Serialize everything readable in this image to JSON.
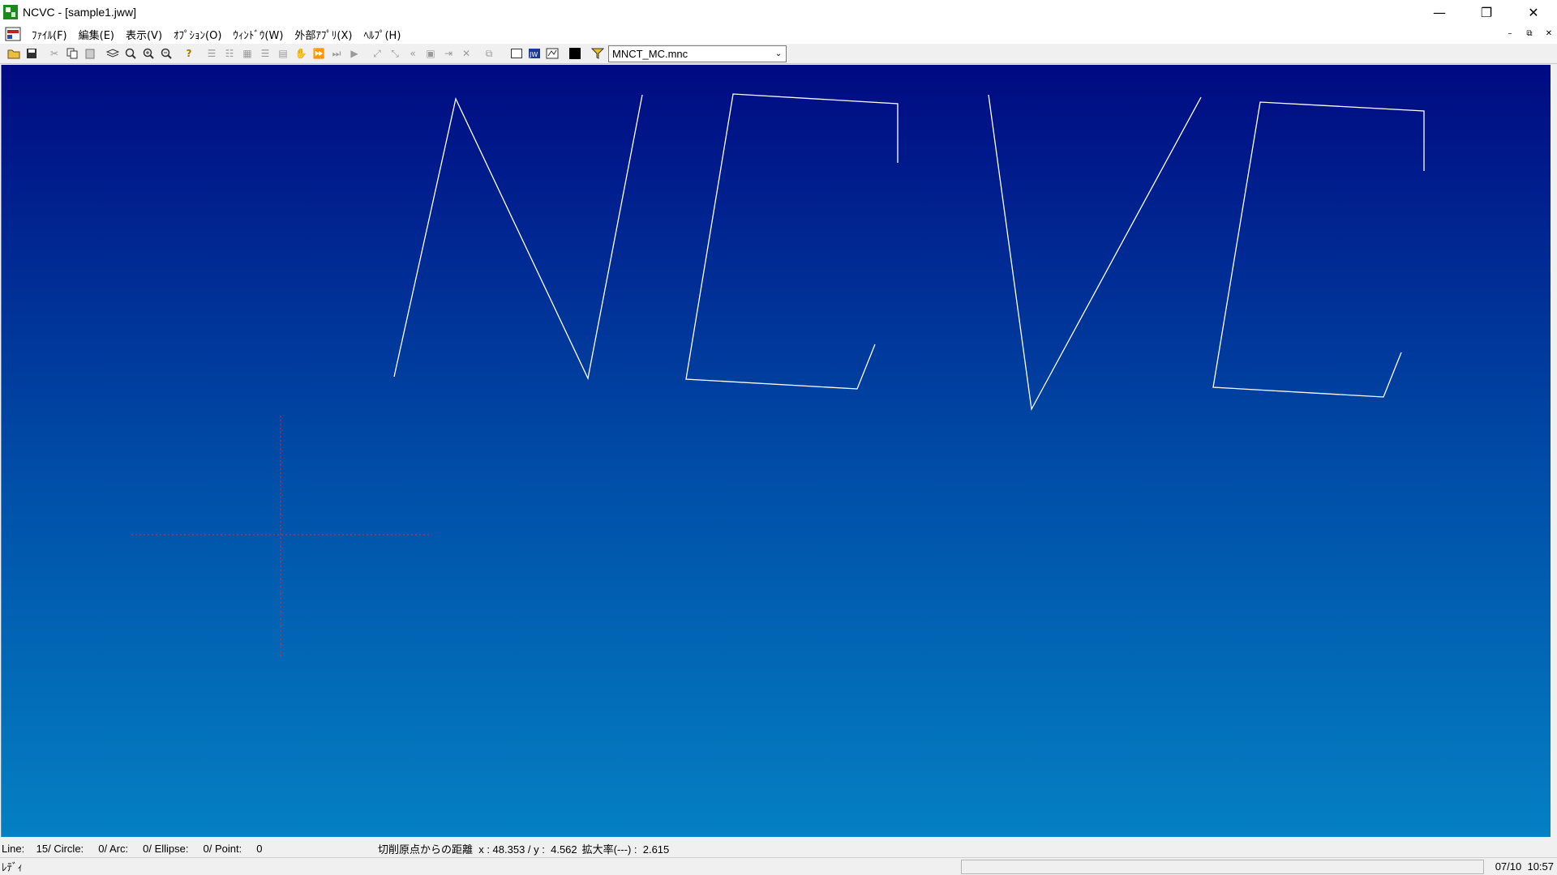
{
  "window": {
    "title": "NCVC - [sample1.jww]",
    "controls": {
      "minimize": "—",
      "restore": "❐",
      "close": "✕"
    }
  },
  "menu": {
    "items": [
      "ﾌｧｲﾙ(F)",
      "編集(E)",
      "表示(V)",
      "ｵﾌﾟｼｮﾝ(O)",
      "ｳｨﾝﾄﾞｳ(W)",
      "外部ｱﾌﾟﾘ(X)",
      "ﾍﾙﾌﾟ(H)"
    ],
    "mdi_controls": [
      "–",
      "⧉",
      "✕"
    ]
  },
  "toolbar": {
    "machine_select": "MNCT_MC.mnc"
  },
  "canvas": {
    "text_drawn": "NCVC",
    "line_color": "#ffffff",
    "origin_marker_color": "#ff2020"
  },
  "status": {
    "counts": "Line:    15/ Circle:     0/ Arc:     0/ Ellipse:     0/ Point:     0",
    "distance": "切削原点からの距離  x : 48.353 / y :  4.562",
    "zoom": "拡大率(---) :  2.615",
    "ready": "ﾚﾃﾞｨ",
    "datetime": "07/10  10:57"
  },
  "colors": {
    "canvas_top": "#000a82",
    "canvas_bottom": "#0480c4"
  }
}
